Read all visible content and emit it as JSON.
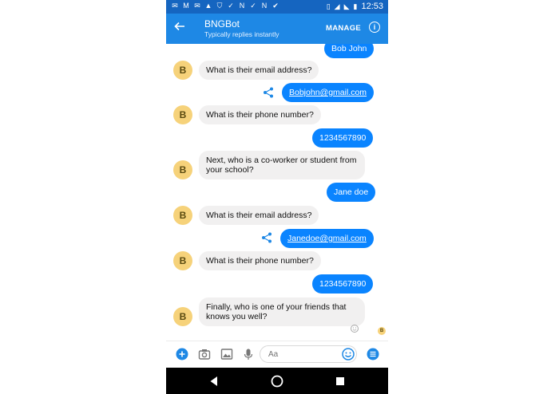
{
  "status": {
    "time": "12:53",
    "icons": [
      "mail-icon",
      "gmail-icon",
      "mail-icon",
      "app-icon",
      "shield-icon",
      "check-icon",
      "n-icon",
      "check-icon",
      "n-icon",
      "check-mark-icon",
      "vibrate-icon",
      "wifi-icon",
      "signal-icon",
      "battery-icon"
    ]
  },
  "header": {
    "title": "BNGBot",
    "subtitle": "Typically replies instantly",
    "manage_label": "MANAGE"
  },
  "messages": [
    {
      "from": "me",
      "text": "Bob John"
    },
    {
      "from": "bot",
      "avatar": "B",
      "text": "What is their email address?"
    },
    {
      "from": "me",
      "text": "Bobjohn@gmail.com",
      "link": true
    },
    {
      "from": "bot",
      "avatar": "B",
      "text": "What is their phone number?"
    },
    {
      "from": "me",
      "text": "1234567890"
    },
    {
      "from": "bot",
      "avatar": "B",
      "text": "Next, who is a co-worker or student from your school?"
    },
    {
      "from": "me",
      "text": "Jane doe"
    },
    {
      "from": "bot",
      "avatar": "B",
      "text": "What is their email address?"
    },
    {
      "from": "me",
      "text": "Janedoe@gmail.com",
      "link": true
    },
    {
      "from": "bot",
      "avatar": "B",
      "text": "What is their phone number?"
    },
    {
      "from": "me",
      "text": "1234567890"
    },
    {
      "from": "bot",
      "avatar": "B",
      "text": "Finally, who is one of your friends that knows you well?"
    }
  ],
  "seen_avatar": "B",
  "composer": {
    "placeholder": "Aa"
  },
  "colors": {
    "appbar": "#1e88e5",
    "statusbar": "#1565c0",
    "outgoing": "#0a84ff",
    "incoming": "#f1f0f0",
    "avatar": "#f6d27a"
  }
}
